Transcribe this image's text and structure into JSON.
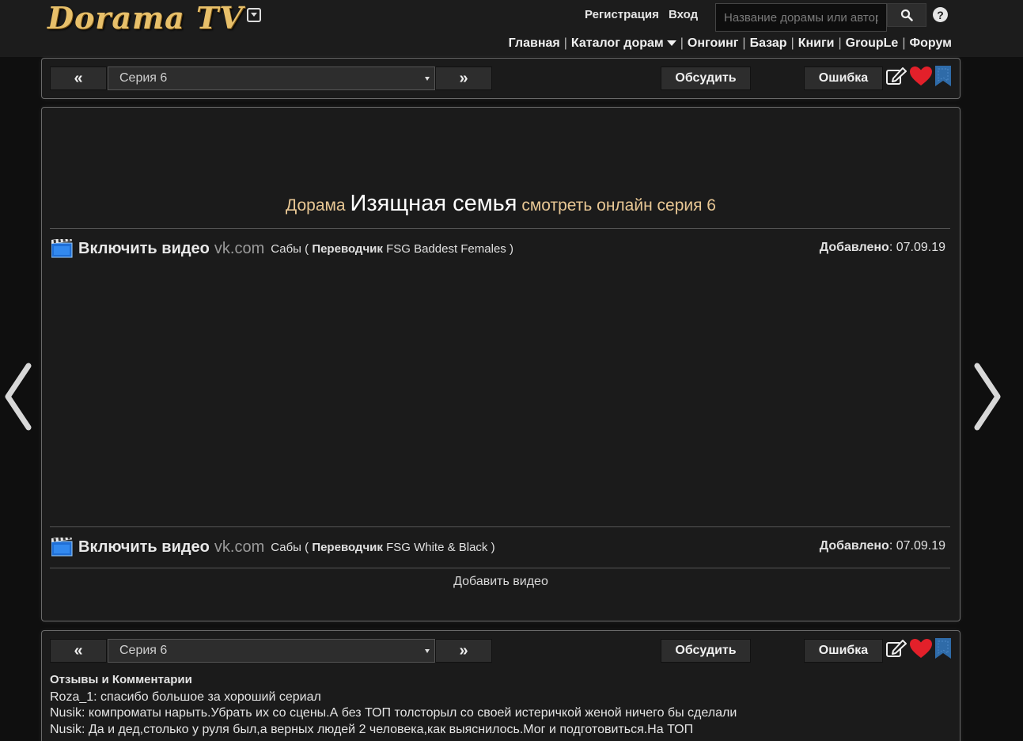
{
  "header": {
    "logo_text": "Dorama TV",
    "register_label": "Регистрация",
    "login_label": "Вход",
    "search_placeholder": "Название дорамы или автора",
    "nav": [
      {
        "label": "Главная"
      },
      {
        "label": "Каталог дорам"
      },
      {
        "label": "Онгоинг"
      },
      {
        "label": "Базар"
      },
      {
        "label": "Книги"
      },
      {
        "label": "GroupLe"
      },
      {
        "label": "Форум"
      }
    ],
    "nav_separator": "|"
  },
  "toolbar": {
    "prev_label": "«",
    "next_label": "»",
    "episode_selected": "Серия 6",
    "discuss_label": "Обсудить",
    "error_label": "Ошибка"
  },
  "title": {
    "prefix": "Дорама",
    "name": "Изящная семья",
    "suffix": "смотреть онлайн серия 6"
  },
  "videos": [
    {
      "enable_label": "Включить видео",
      "host": "vk.com",
      "subs_open": "Сабы (",
      "translator_label": "Переводчик",
      "translator_name": "FSG Baddest Females )",
      "added_label": "Добавлено",
      "added_date": ": 07.09.19"
    },
    {
      "enable_label": "Включить видео",
      "host": "vk.com",
      "subs_open": "Сабы (",
      "translator_label": "Переводчик",
      "translator_name": "FSG White & Black )",
      "added_label": "Добавлено",
      "added_date": ": 07.09.19"
    }
  ],
  "add_video_label": "Добавить видео",
  "comments": {
    "heading": "Отзывы и Комментарии",
    "items": [
      "Roza_1: спасибо большое за хороший сериал",
      "Nusik: компроматы нарыть.Убрать их со сцены.А без ТОП толсторыл со своей истеричкой женой ничего бы сделали",
      "Nusik: Да и дед,столько у руля был,а верных людей 2 человека,как выяснилось.Мог и подготовиться.На ТОП"
    ]
  },
  "colors": {
    "background": "#0f0f0f",
    "header_bg": "#1c1c1c",
    "panel_bg": "#1b1b1b",
    "title_accent": "#e8c794",
    "logo_gold": "#e8c06a",
    "heart": "#e3202a",
    "bookmark": "#2f6ba8"
  },
  "icons": [
    "film-icon",
    "search-icon",
    "help-icon",
    "edit-icon",
    "heart-icon",
    "bookmark-icon",
    "chevron-left-icon",
    "chevron-right-icon"
  ]
}
